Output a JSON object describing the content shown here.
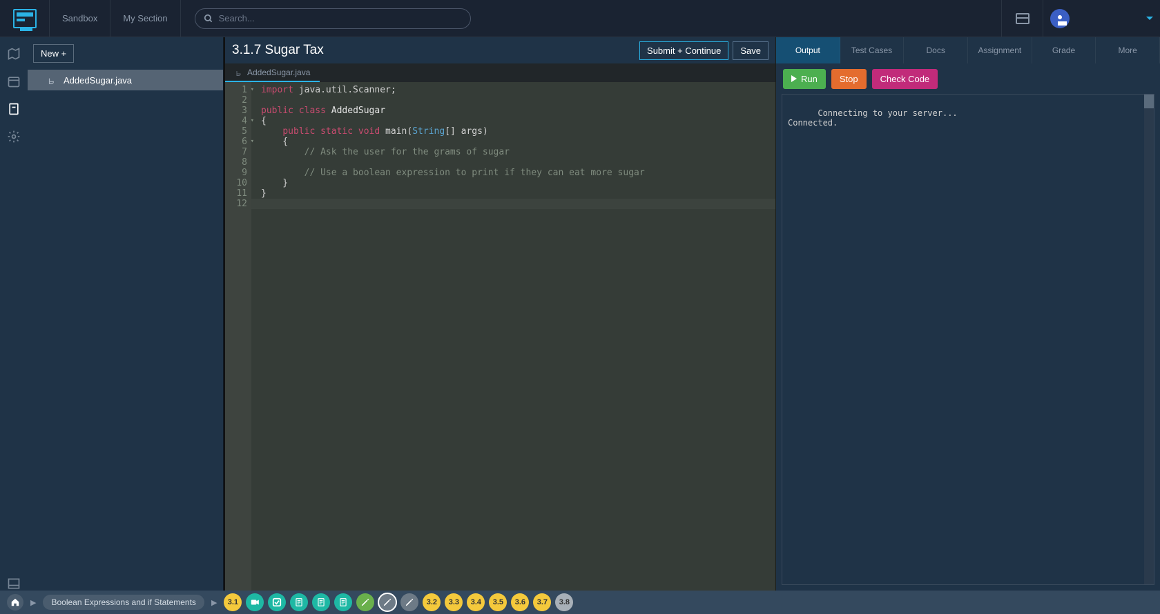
{
  "topnav": {
    "sandbox": "Sandbox",
    "mysection": "My Section",
    "search_placeholder": "Search..."
  },
  "sidebar": {
    "new_button": "New +"
  },
  "files": {
    "active": "AddedSugar.java"
  },
  "editor": {
    "title": "3.1.7 Sugar Tax",
    "submit": "Submit + Continue",
    "save": "Save",
    "tab_file": "AddedSugar.java",
    "line_numbers": [
      "1",
      "2",
      "3",
      "4",
      "5",
      "6",
      "7",
      "8",
      "9",
      "10",
      "11",
      "12"
    ],
    "fold_lines": [
      1,
      4,
      6
    ],
    "code": {
      "l1_import": "import",
      "l1_rest": " java.util.Scanner;",
      "l3_public": "public",
      "l3_class": "class",
      "l3_name": " AddedSugar",
      "l4_brace": "{",
      "l5_indent": "    ",
      "l5_public": "public",
      "l5_static": "static",
      "l5_void": "void",
      "l5_main": " main(",
      "l5_string": "String",
      "l5_args": "[] args)",
      "l6": "    {",
      "l7": "        // Ask the user for the grams of sugar",
      "l9": "        // Use a boolean expression to print if they can eat more sugar",
      "l10": "    }",
      "l11": "}"
    }
  },
  "right": {
    "tabs": {
      "output": "Output",
      "testcases": "Test Cases",
      "docs": "Docs",
      "assignment": "Assignment",
      "grade": "Grade",
      "more": "More"
    },
    "buttons": {
      "run": "Run",
      "stop": "Stop",
      "check": "Check Code"
    },
    "console_text": "Connecting to your server...\nConnected."
  },
  "bottom": {
    "breadcrumb": "Boolean Expressions and if Statements",
    "nodes": [
      {
        "label": "3.1",
        "color": "c-yellow",
        "icon": ""
      },
      {
        "label": "",
        "color": "c-teal",
        "icon": "video"
      },
      {
        "label": "",
        "color": "c-teal",
        "icon": "check"
      },
      {
        "label": "",
        "color": "c-teal",
        "icon": "doc"
      },
      {
        "label": "",
        "color": "c-teal",
        "icon": "doc"
      },
      {
        "label": "",
        "color": "c-teal",
        "icon": "doc"
      },
      {
        "label": "",
        "color": "c-green",
        "icon": "pencil"
      },
      {
        "label": "",
        "color": "c-grey",
        "icon": "pencil",
        "current": true
      },
      {
        "label": "",
        "color": "c-grey",
        "icon": "pencil"
      },
      {
        "label": "3.2",
        "color": "c-yellow",
        "icon": ""
      },
      {
        "label": "3.3",
        "color": "c-yellow",
        "icon": ""
      },
      {
        "label": "3.4",
        "color": "c-yellow",
        "icon": ""
      },
      {
        "label": "3.5",
        "color": "c-yellow",
        "icon": ""
      },
      {
        "label": "3.6",
        "color": "c-yellow",
        "icon": ""
      },
      {
        "label": "3.7",
        "color": "c-yellow",
        "icon": ""
      },
      {
        "label": "3.8",
        "color": "c-silver",
        "icon": ""
      }
    ]
  }
}
